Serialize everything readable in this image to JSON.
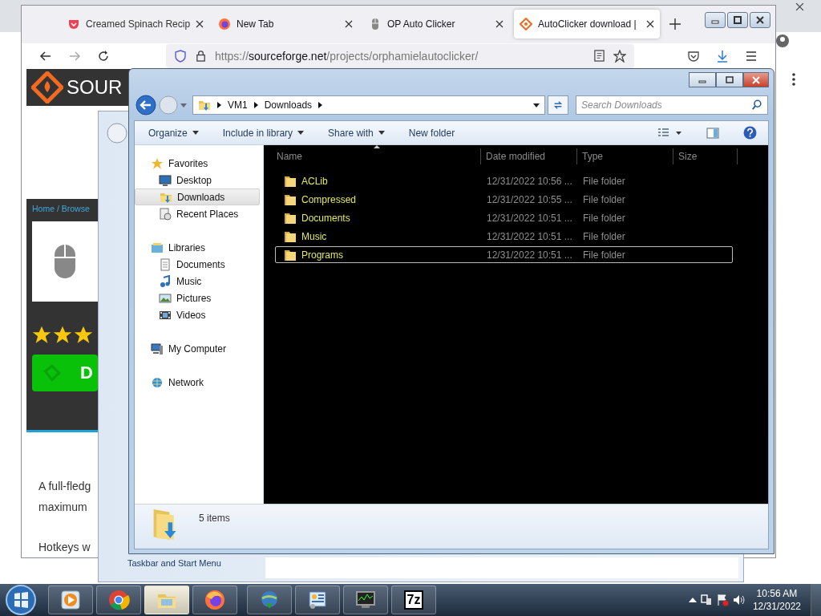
{
  "browser": {
    "tabs": [
      {
        "title": "Creamed Spinach Recip",
        "kind": "pocket",
        "selected": false
      },
      {
        "title": "New Tab",
        "kind": "firefox",
        "selected": false
      },
      {
        "title": "OP Auto Clicker",
        "kind": "mouse",
        "selected": false
      },
      {
        "title": "AutoClicker download |",
        "kind": "sourceforge",
        "selected": true
      }
    ],
    "url": {
      "scheme": "https://",
      "host": "sourceforge.net",
      "path": "/projects/orphamielautoclicker/"
    },
    "page": {
      "logo": "SOUR",
      "breadcrumb": "Home / Browse",
      "stars": 3,
      "download_label": "D",
      "paragraph": [
        "A full-fledg",
        "maximum"
      ],
      "hotkeys_text": "Hotkeys w"
    }
  },
  "background_window": {
    "text": "Taskbar and Start Menu"
  },
  "explorer": {
    "breadcrumb": [
      "VM1",
      "Downloads"
    ],
    "search_placeholder": "Search Downloads",
    "toolbar": [
      {
        "label": "Organize",
        "dropdown": true
      },
      {
        "label": "Include in library",
        "dropdown": true
      },
      {
        "label": "Share with",
        "dropdown": true
      },
      {
        "label": "New folder",
        "dropdown": false
      }
    ],
    "nav": [
      {
        "label": "Favorites",
        "kind": "star",
        "selected": false,
        "children": [
          {
            "label": "Desktop",
            "kind": "desktop",
            "selected": false
          },
          {
            "label": "Downloads",
            "kind": "downloads",
            "selected": true
          },
          {
            "label": "Recent Places",
            "kind": "recent",
            "selected": false
          }
        ]
      },
      {
        "label": "Libraries",
        "kind": "libraries",
        "selected": false,
        "children": [
          {
            "label": "Documents",
            "kind": "documents",
            "selected": false
          },
          {
            "label": "Music",
            "kind": "music",
            "selected": false
          },
          {
            "label": "Pictures",
            "kind": "pictures",
            "selected": false
          },
          {
            "label": "Videos",
            "kind": "videos",
            "selected": false
          }
        ]
      },
      {
        "label": "My Computer",
        "kind": "computer",
        "selected": false
      },
      {
        "label": "Network",
        "kind": "network",
        "selected": false
      }
    ],
    "columns": [
      "Name",
      "Date modified",
      "Type",
      "Size"
    ],
    "rows": [
      {
        "name": "ACLib",
        "date": "12/31/2022 10:56 ...",
        "type": "File folder",
        "selected": false
      },
      {
        "name": "Compressed",
        "date": "12/31/2022 10:55 ...",
        "type": "File folder",
        "selected": false
      },
      {
        "name": "Documents",
        "date": "12/31/2022 10:51 ...",
        "type": "File folder",
        "selected": false
      },
      {
        "name": "Music",
        "date": "12/31/2022 10:51 ...",
        "type": "File folder",
        "selected": false
      },
      {
        "name": "Programs",
        "date": "12/31/2022 10:51 ...",
        "type": "File folder",
        "selected": true
      }
    ],
    "status": "5 items"
  },
  "taskbar": {
    "apps": [
      {
        "kind": "media",
        "active": false
      },
      {
        "kind": "chrome",
        "active": false
      },
      {
        "kind": "explorer",
        "active": true
      },
      {
        "kind": "firefox",
        "active": false
      },
      {
        "kind": "idm",
        "active": false
      },
      {
        "kind": "controlpanel",
        "active": false
      },
      {
        "kind": "taskmgr",
        "active": false
      },
      {
        "kind": "sevenzip",
        "active": false,
        "label": "7z"
      }
    ],
    "time": "10:56 AM",
    "date": "12/31/2022"
  }
}
